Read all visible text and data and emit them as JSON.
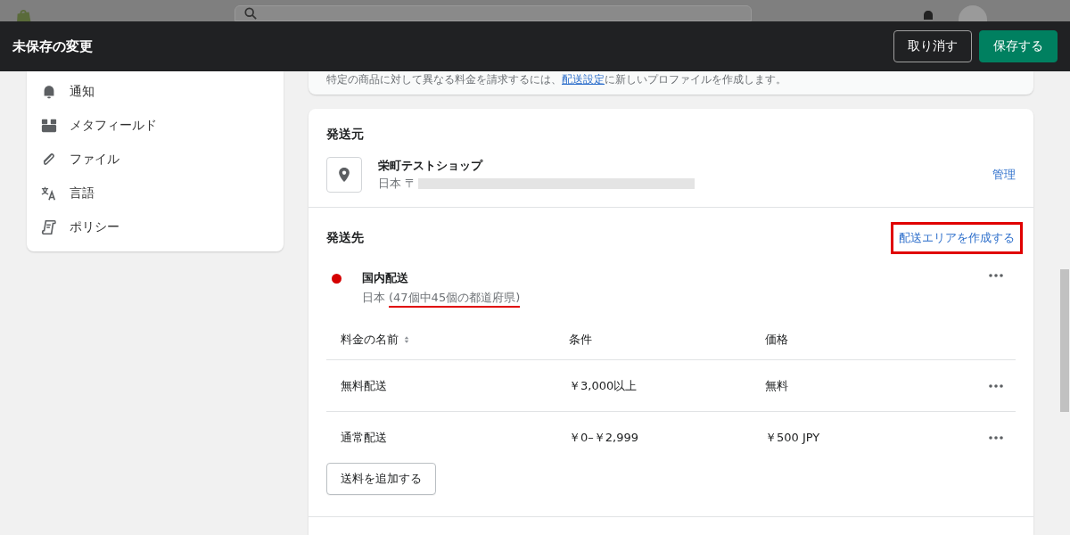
{
  "unsaved_bar": {
    "title": "未保存の変更",
    "buttons": [
      {
        "label": "取り消す",
        "kind": "secondary"
      },
      {
        "label": "保存する",
        "kind": "primary"
      }
    ]
  },
  "sidebar": {
    "items": [
      {
        "label": "通知"
      },
      {
        "label": "メタフィールド"
      },
      {
        "label": "ファイル"
      },
      {
        "label": "言語"
      },
      {
        "label": "ポリシー"
      }
    ]
  },
  "profile_note": {
    "before": "特定の商品に対して異なる料金を請求するには、",
    "link": "配送設定",
    "after": "に新しいプロファイルを作成します。"
  },
  "ship_from": {
    "heading": "発送元",
    "name": "栄町テストショップ",
    "address": "日本 〒",
    "address_redacted": true,
    "manage_link": "管理"
  },
  "ship_to": {
    "heading": "発送先",
    "create_link": "配送エリアを作成する",
    "zones": [
      {
        "name": "国内配送",
        "color": "#d50000",
        "country": "日本",
        "detail": "(47個中45個の都道府県)"
      }
    ]
  },
  "rates": {
    "columns": [
      {
        "label": "料金の名前",
        "sortable": true
      },
      {
        "label": "条件",
        "sortable": false
      },
      {
        "label": "価格",
        "sortable": false
      }
    ],
    "rows": [
      {
        "name": "無料配送",
        "condition": "￥3,000以上",
        "price": "無料"
      },
      {
        "name": "通常配送",
        "condition": "￥0–￥2,999",
        "price": "￥500 JPY"
      }
    ],
    "add_button": "送料を追加する"
  }
}
